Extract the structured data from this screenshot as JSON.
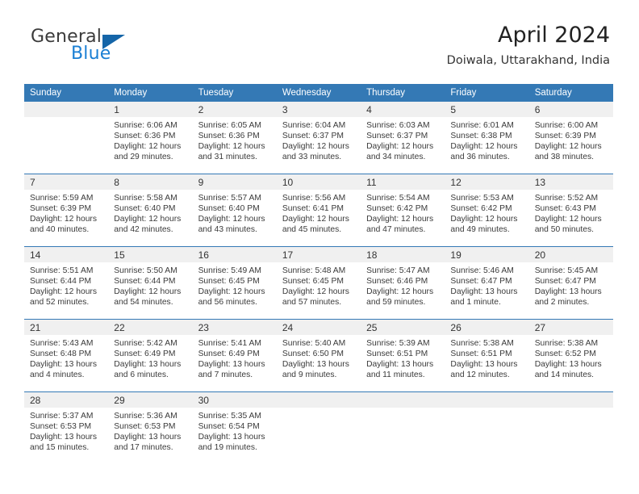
{
  "brand": {
    "name_part1": "General",
    "name_part2": "Blue",
    "triangle_color": "#1565a8",
    "blue_text_color": "#1a7fd4"
  },
  "header": {
    "title": "April 2024",
    "location": "Doiwala, Uttarakhand, India"
  },
  "theme": {
    "header_blue": "#3479b5",
    "daynum_band": "#f0f0f0",
    "text": "#3a3a3a"
  },
  "weekday_headers": [
    "Sunday",
    "Monday",
    "Tuesday",
    "Wednesday",
    "Thursday",
    "Friday",
    "Saturday"
  ],
  "weeks": [
    [
      {
        "day": "",
        "lines": []
      },
      {
        "day": "1",
        "lines": [
          "Sunrise: 6:06 AM",
          "Sunset: 6:36 PM",
          "Daylight: 12 hours",
          "and 29 minutes."
        ]
      },
      {
        "day": "2",
        "lines": [
          "Sunrise: 6:05 AM",
          "Sunset: 6:36 PM",
          "Daylight: 12 hours",
          "and 31 minutes."
        ]
      },
      {
        "day": "3",
        "lines": [
          "Sunrise: 6:04 AM",
          "Sunset: 6:37 PM",
          "Daylight: 12 hours",
          "and 33 minutes."
        ]
      },
      {
        "day": "4",
        "lines": [
          "Sunrise: 6:03 AM",
          "Sunset: 6:37 PM",
          "Daylight: 12 hours",
          "and 34 minutes."
        ]
      },
      {
        "day": "5",
        "lines": [
          "Sunrise: 6:01 AM",
          "Sunset: 6:38 PM",
          "Daylight: 12 hours",
          "and 36 minutes."
        ]
      },
      {
        "day": "6",
        "lines": [
          "Sunrise: 6:00 AM",
          "Sunset: 6:39 PM",
          "Daylight: 12 hours",
          "and 38 minutes."
        ]
      }
    ],
    [
      {
        "day": "7",
        "lines": [
          "Sunrise: 5:59 AM",
          "Sunset: 6:39 PM",
          "Daylight: 12 hours",
          "and 40 minutes."
        ]
      },
      {
        "day": "8",
        "lines": [
          "Sunrise: 5:58 AM",
          "Sunset: 6:40 PM",
          "Daylight: 12 hours",
          "and 42 minutes."
        ]
      },
      {
        "day": "9",
        "lines": [
          "Sunrise: 5:57 AM",
          "Sunset: 6:40 PM",
          "Daylight: 12 hours",
          "and 43 minutes."
        ]
      },
      {
        "day": "10",
        "lines": [
          "Sunrise: 5:56 AM",
          "Sunset: 6:41 PM",
          "Daylight: 12 hours",
          "and 45 minutes."
        ]
      },
      {
        "day": "11",
        "lines": [
          "Sunrise: 5:54 AM",
          "Sunset: 6:42 PM",
          "Daylight: 12 hours",
          "and 47 minutes."
        ]
      },
      {
        "day": "12",
        "lines": [
          "Sunrise: 5:53 AM",
          "Sunset: 6:42 PM",
          "Daylight: 12 hours",
          "and 49 minutes."
        ]
      },
      {
        "day": "13",
        "lines": [
          "Sunrise: 5:52 AM",
          "Sunset: 6:43 PM",
          "Daylight: 12 hours",
          "and 50 minutes."
        ]
      }
    ],
    [
      {
        "day": "14",
        "lines": [
          "Sunrise: 5:51 AM",
          "Sunset: 6:44 PM",
          "Daylight: 12 hours",
          "and 52 minutes."
        ]
      },
      {
        "day": "15",
        "lines": [
          "Sunrise: 5:50 AM",
          "Sunset: 6:44 PM",
          "Daylight: 12 hours",
          "and 54 minutes."
        ]
      },
      {
        "day": "16",
        "lines": [
          "Sunrise: 5:49 AM",
          "Sunset: 6:45 PM",
          "Daylight: 12 hours",
          "and 56 minutes."
        ]
      },
      {
        "day": "17",
        "lines": [
          "Sunrise: 5:48 AM",
          "Sunset: 6:45 PM",
          "Daylight: 12 hours",
          "and 57 minutes."
        ]
      },
      {
        "day": "18",
        "lines": [
          "Sunrise: 5:47 AM",
          "Sunset: 6:46 PM",
          "Daylight: 12 hours",
          "and 59 minutes."
        ]
      },
      {
        "day": "19",
        "lines": [
          "Sunrise: 5:46 AM",
          "Sunset: 6:47 PM",
          "Daylight: 13 hours",
          "and 1 minute."
        ]
      },
      {
        "day": "20",
        "lines": [
          "Sunrise: 5:45 AM",
          "Sunset: 6:47 PM",
          "Daylight: 13 hours",
          "and 2 minutes."
        ]
      }
    ],
    [
      {
        "day": "21",
        "lines": [
          "Sunrise: 5:43 AM",
          "Sunset: 6:48 PM",
          "Daylight: 13 hours",
          "and 4 minutes."
        ]
      },
      {
        "day": "22",
        "lines": [
          "Sunrise: 5:42 AM",
          "Sunset: 6:49 PM",
          "Daylight: 13 hours",
          "and 6 minutes."
        ]
      },
      {
        "day": "23",
        "lines": [
          "Sunrise: 5:41 AM",
          "Sunset: 6:49 PM",
          "Daylight: 13 hours",
          "and 7 minutes."
        ]
      },
      {
        "day": "24",
        "lines": [
          "Sunrise: 5:40 AM",
          "Sunset: 6:50 PM",
          "Daylight: 13 hours",
          "and 9 minutes."
        ]
      },
      {
        "day": "25",
        "lines": [
          "Sunrise: 5:39 AM",
          "Sunset: 6:51 PM",
          "Daylight: 13 hours",
          "and 11 minutes."
        ]
      },
      {
        "day": "26",
        "lines": [
          "Sunrise: 5:38 AM",
          "Sunset: 6:51 PM",
          "Daylight: 13 hours",
          "and 12 minutes."
        ]
      },
      {
        "day": "27",
        "lines": [
          "Sunrise: 5:38 AM",
          "Sunset: 6:52 PM",
          "Daylight: 13 hours",
          "and 14 minutes."
        ]
      }
    ],
    [
      {
        "day": "28",
        "lines": [
          "Sunrise: 5:37 AM",
          "Sunset: 6:53 PM",
          "Daylight: 13 hours",
          "and 15 minutes."
        ]
      },
      {
        "day": "29",
        "lines": [
          "Sunrise: 5:36 AM",
          "Sunset: 6:53 PM",
          "Daylight: 13 hours",
          "and 17 minutes."
        ]
      },
      {
        "day": "30",
        "lines": [
          "Sunrise: 5:35 AM",
          "Sunset: 6:54 PM",
          "Daylight: 13 hours",
          "and 19 minutes."
        ]
      },
      {
        "day": "",
        "lines": []
      },
      {
        "day": "",
        "lines": []
      },
      {
        "day": "",
        "lines": []
      },
      {
        "day": "",
        "lines": []
      }
    ]
  ]
}
